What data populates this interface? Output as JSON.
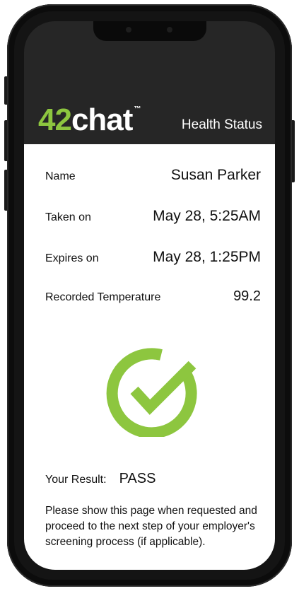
{
  "app": {
    "logo_number": "42",
    "logo_word": "chat",
    "logo_tm": "™",
    "brand_color": "#8dc63f",
    "header_title": "Health Status"
  },
  "fields": [
    {
      "label": "Name",
      "value": "Susan Parker"
    },
    {
      "label": "Taken on",
      "value": "May 28, 5:25AM"
    },
    {
      "label": "Expires on",
      "value": "May 28, 1:25PM"
    },
    {
      "label": "Recorded Temperature",
      "value": "99.2"
    }
  ],
  "result": {
    "icon": "checkmark-circle-icon",
    "label": "Your Result:",
    "value": "PASS",
    "instructions": "Please show this page when requested and proceed to the next step of your employer's screening process (if applicable)."
  },
  "colors": {
    "header_bg": "#262626",
    "check_green": "#8dc63f"
  }
}
